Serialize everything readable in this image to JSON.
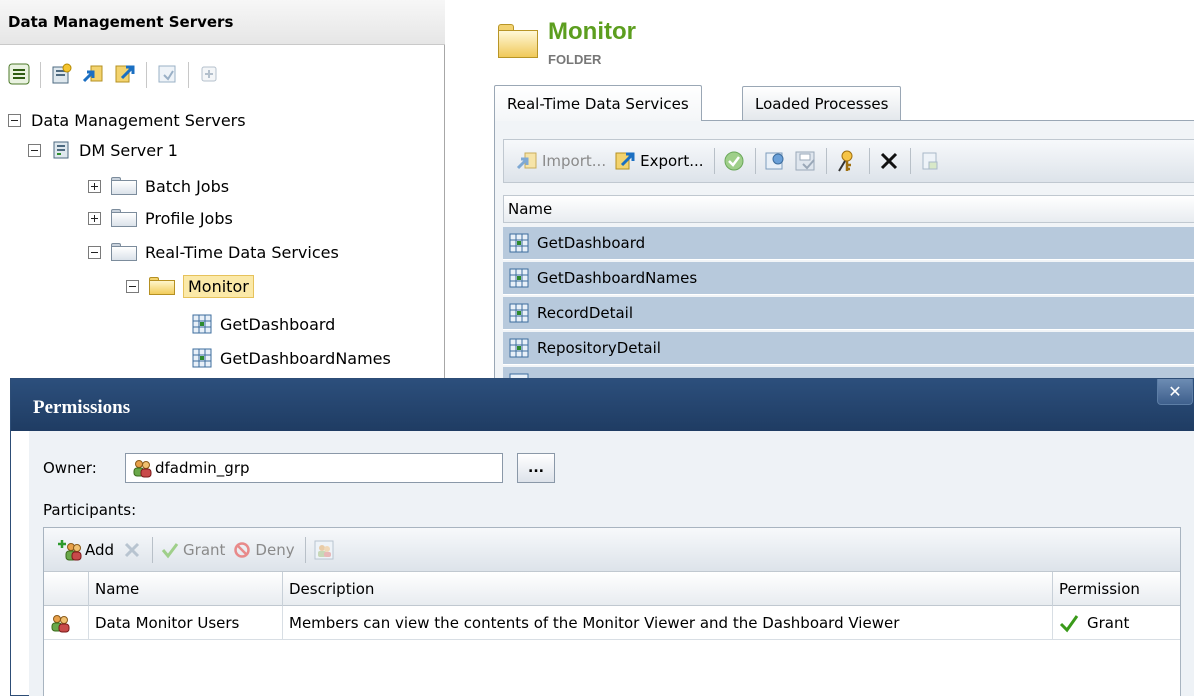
{
  "left_pane": {
    "title": "Data Management Servers",
    "toolbar_icons": [
      "collapse-icon",
      "new-server-icon",
      "import-icon",
      "export-icon",
      "properties-icon",
      "add-icon"
    ],
    "tree": [
      {
        "label": "Data Management Servers",
        "expander": "minus",
        "icon": "none"
      },
      {
        "label": "DM Server 1",
        "expander": "minus",
        "icon": "server-icon"
      },
      {
        "label": "Batch Jobs",
        "expander": "plus",
        "icon": "folder-icon"
      },
      {
        "label": "Profile Jobs",
        "expander": "plus",
        "icon": "folder-icon"
      },
      {
        "label": "Real-Time Data Services",
        "expander": "minus",
        "icon": "folder-icon"
      },
      {
        "label": "Monitor",
        "expander": "minus",
        "icon": "folder-icon",
        "selected": true
      },
      {
        "label": "GetDashboard",
        "icon": "service-icon"
      },
      {
        "label": "GetDashboardNames",
        "icon": "service-icon"
      }
    ]
  },
  "right_pane": {
    "title": "Monitor",
    "subtitle": "FOLDER",
    "tabs": [
      {
        "label": "Real-Time Data Services",
        "active": true
      },
      {
        "label": "Loaded Processes",
        "active": false
      }
    ],
    "toolbar": {
      "import_label": "Import...",
      "export_label": "Export..."
    },
    "grid_header": "Name",
    "services": [
      "GetDashboard",
      "GetDashboardNames",
      "RecordDetail",
      "RepositoryDetail"
    ]
  },
  "dialog": {
    "title": "Permissions",
    "close_label": "✕",
    "owner_label": "Owner:",
    "owner_value": "dfadmin_grp",
    "browse_label": "...",
    "participants_label": "Participants:",
    "toolbar": {
      "add_label": "Add",
      "grant_label": "Grant",
      "deny_label": "Deny"
    },
    "columns": [
      "Name",
      "Description",
      "Permission"
    ],
    "rows": [
      {
        "name": "Data Monitor Users",
        "description": "Members can view the contents of the Monitor Viewer and the Dashboard Viewer",
        "permission": "Grant"
      }
    ]
  },
  "colors": {
    "title_green": "#5c9e1f",
    "dialog_titlebar": "#1f3c63",
    "selected_row": "#b7c9dc",
    "grant_check": "#3a9a1a"
  }
}
